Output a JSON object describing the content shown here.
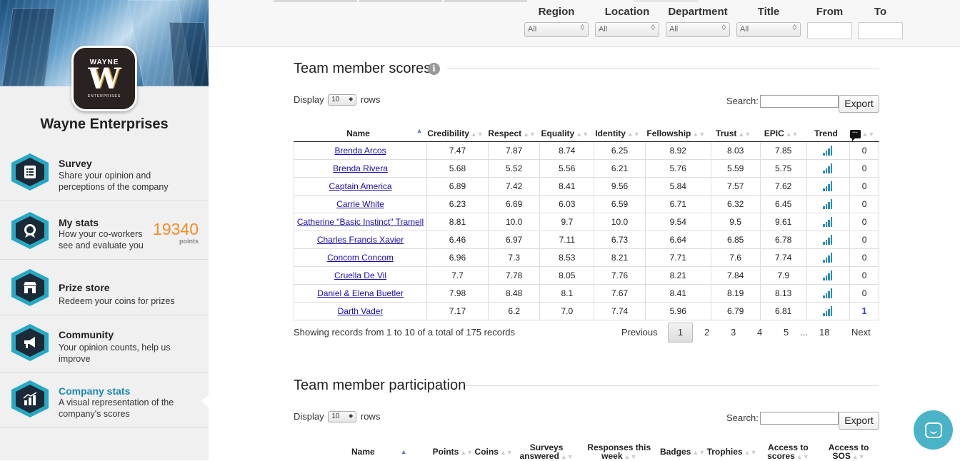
{
  "brand": {
    "logo_wordmark": "WAYNE",
    "logo_letter": "W",
    "logo_sub": "ENTERPRISES",
    "company_name": "Wayne Enterprises"
  },
  "nav": [
    {
      "title": "Survey",
      "desc": "Share your opinion and perceptions of the company",
      "icon": "survey-document-icon"
    },
    {
      "title": "My stats",
      "desc": "How your co-workers see and evaluate you",
      "icon": "medal-icon"
    },
    {
      "title": "Prize store",
      "desc": "Redeem your coins for prizes",
      "icon": "store-icon"
    },
    {
      "title": "Community",
      "desc": "Your opinion counts, help us improve",
      "icon": "megaphone-icon"
    },
    {
      "title": "Company stats",
      "desc": "A visual representation of the company's scores",
      "icon": "chart-growth-icon"
    }
  ],
  "points": {
    "value": "19340",
    "label": "points"
  },
  "filters": {
    "region": {
      "label": "Region",
      "value": "All"
    },
    "location": {
      "label": "Location",
      "value": "All"
    },
    "department": {
      "label": "Department",
      "value": "All"
    },
    "title": {
      "label": "Title",
      "value": "All"
    },
    "from": {
      "label": "From",
      "value": ""
    },
    "to": {
      "label": "To",
      "value": ""
    }
  },
  "scores_section": {
    "title": "Team member scores",
    "display_prefix": "Display",
    "display_value": "10",
    "display_suffix": "rows",
    "search_label": "Search:",
    "export_label": "Export",
    "columns": [
      "Name",
      "Credibility",
      "Respect",
      "Equality",
      "Identity",
      "Fellowship",
      "Trust",
      "EPIC",
      "Trend",
      ""
    ],
    "rows": [
      [
        "Brenda Arcos",
        "7.47",
        "7.87",
        "8.74",
        "6.25",
        "8.92",
        "8.03",
        "7.85",
        "0"
      ],
      [
        "Brenda Rivera",
        "5.68",
        "5.52",
        "5.56",
        "6.21",
        "5.76",
        "5.59",
        "5.75",
        "0"
      ],
      [
        "Captain America",
        "6.89",
        "7.42",
        "8.41",
        "9.56",
        "5.84",
        "7.57",
        "7.62",
        "0"
      ],
      [
        "Carrie White",
        "6.23",
        "6.69",
        "6.03",
        "6.59",
        "6.71",
        "6.32",
        "6.45",
        "0"
      ],
      [
        "Catherine \"Basic Instinct\" Tramell",
        "8.81",
        "10.0",
        "9.7",
        "10.0",
        "9.54",
        "9.5",
        "9.61",
        "0"
      ],
      [
        "Charles Francis Xavier",
        "6.46",
        "6.97",
        "7.11",
        "6.73",
        "6.64",
        "6.85",
        "6.78",
        "0"
      ],
      [
        "Concom Concom",
        "6.96",
        "7.3",
        "8.53",
        "8.21",
        "7.71",
        "7.6",
        "7.74",
        "0"
      ],
      [
        "Cruella De Vil",
        "7.7",
        "7.78",
        "8.05",
        "7.76",
        "8.21",
        "7.84",
        "7.9",
        "0"
      ],
      [
        "Daniel & Elena Buetler",
        "7.98",
        "8.48",
        "8.1",
        "7.67",
        "8.41",
        "8.19",
        "8.13",
        "0"
      ],
      [
        "Darth Vader",
        "7.17",
        "6.2",
        "7.0",
        "7.74",
        "5.96",
        "6.79",
        "6.81",
        "1"
      ]
    ],
    "records_info": "Showing records from 1 to 10 of a total of 175 records",
    "pager": {
      "previous": "Previous",
      "pages": [
        "1",
        "2",
        "3",
        "4",
        "5",
        "...",
        "18"
      ],
      "next": "Next",
      "current": "1"
    }
  },
  "participation_section": {
    "title": "Team member participation",
    "display_prefix": "Display",
    "display_value": "10",
    "display_suffix": "rows",
    "search_label": "Search:",
    "export_label": "Export",
    "columns": [
      "Name",
      "Points",
      "Coins",
      "Surveys answered",
      "Responses this week",
      "Badges",
      "Trophies",
      "Access to scores",
      "Access to SOS"
    ]
  },
  "colors": {
    "accent": "#27a8c4",
    "points": "#f28c28",
    "active_nav": "#1c86b5",
    "chat": "#4ab3c8"
  }
}
